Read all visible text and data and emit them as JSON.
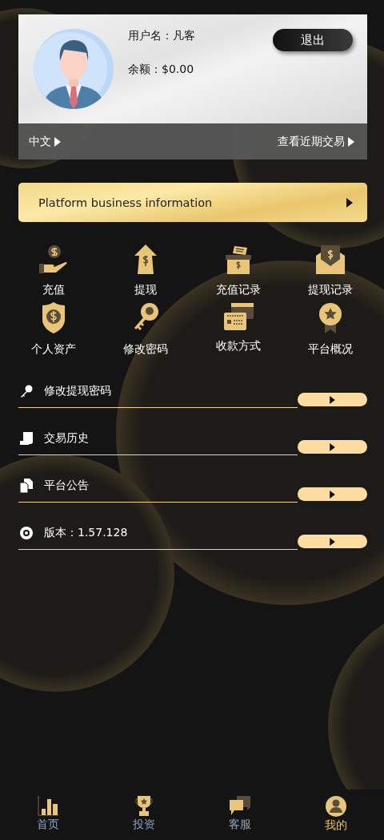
{
  "profile": {
    "username_label": "用户名：凡客",
    "balance_label": "余额：$0.00",
    "logout": "退出",
    "language": "中文",
    "recent_transactions": "查看近期交易"
  },
  "banner": {
    "label": "Platform business information"
  },
  "shortcuts": [
    {
      "label": "充值"
    },
    {
      "label": "提现"
    },
    {
      "label": "充值记录"
    },
    {
      "label": "提现记录"
    },
    {
      "label": "个人资产"
    },
    {
      "label": "修改密码"
    },
    {
      "label": "收款方式"
    },
    {
      "label": "平台概况"
    }
  ],
  "menu": [
    {
      "label": "修改提现密码"
    },
    {
      "label": "交易历史"
    },
    {
      "label": "平台公告"
    },
    {
      "label": "版本：1.57.128"
    }
  ],
  "bottom_nav": [
    {
      "label": "首页",
      "selected": false
    },
    {
      "label": "投资",
      "selected": false
    },
    {
      "label": "客服",
      "selected": false
    },
    {
      "label": "我的",
      "selected": true
    }
  ]
}
